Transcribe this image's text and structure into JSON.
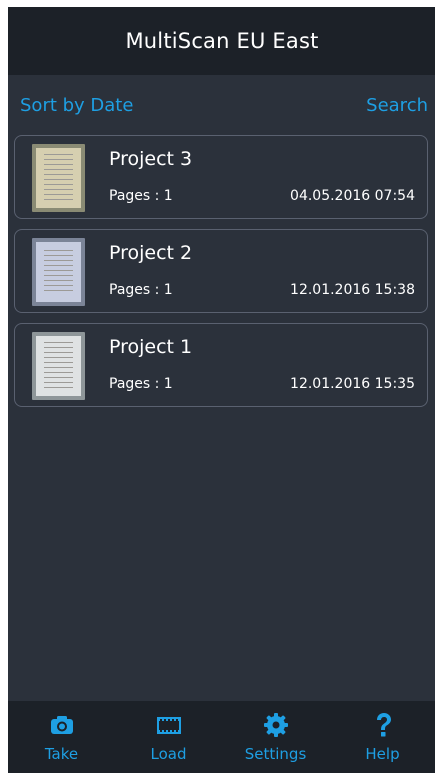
{
  "app": {
    "title": "MultiScan EU East"
  },
  "toolbar": {
    "sort_label": "Sort by Date",
    "search_label": "Search"
  },
  "projects": [
    {
      "name": "Project 3",
      "pages": "Pages : 1",
      "date": "04.05.2016 07:54",
      "thumb_tint": "#c9c2a5"
    },
    {
      "name": "Project 2",
      "pages": "Pages : 1",
      "date": "12.01.2016 15:38",
      "thumb_tint": "#b7bfd2"
    },
    {
      "name": "Project 1",
      "pages": "Pages : 1",
      "date": "12.01.2016 15:35",
      "thumb_tint": "#d2d6d8"
    }
  ],
  "tabs": [
    {
      "label": "Take",
      "icon": "camera-icon"
    },
    {
      "label": "Load",
      "icon": "film-frame-icon"
    },
    {
      "label": "Settings",
      "icon": "gear-icon"
    },
    {
      "label": "Help",
      "icon": "question-mark-icon"
    }
  ],
  "colors": {
    "accent": "#1e9fe3",
    "background": "#2b313b",
    "bar": "#1c2128"
  }
}
